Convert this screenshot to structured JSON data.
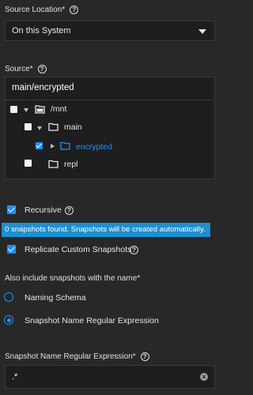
{
  "source_location": {
    "label": "Source Location",
    "required_mark": "*",
    "selected": "On this System"
  },
  "source": {
    "label": "Source",
    "required_mark": "*",
    "value": "main/encrypted",
    "tree": [
      {
        "name": "/mnt",
        "checked": false,
        "expanded": true,
        "icon": "folder-open-icon"
      },
      {
        "name": "main",
        "checked": false,
        "expanded": true,
        "icon": "folder-icon"
      },
      {
        "name": "encrypted",
        "checked": true,
        "expanded": false,
        "icon": "folder-icon",
        "highlight": "#1e90ff"
      },
      {
        "name": "repl",
        "checked": false,
        "expanded": false,
        "icon": "folder-icon"
      }
    ]
  },
  "recursive": {
    "label": "Recursive",
    "checked": true
  },
  "banner": {
    "text": "0 snapshots found. Snapshots will be created automatically."
  },
  "replicate_custom": {
    "label": "Replicate Custom Snapshots",
    "checked": true
  },
  "also_include": {
    "label": "Also include snapshots with the name",
    "required_mark": "*",
    "options": [
      {
        "label": "Naming Schema",
        "selected": false
      },
      {
        "label": "Snapshot Name Regular Expression",
        "selected": true
      }
    ]
  },
  "regex": {
    "label": "Snapshot Name Regular Expression",
    "required_mark": "*",
    "value": ".*"
  },
  "colors": {
    "accent": "#1e90ff",
    "banner": "#1f8fd0",
    "background": "#282828"
  }
}
